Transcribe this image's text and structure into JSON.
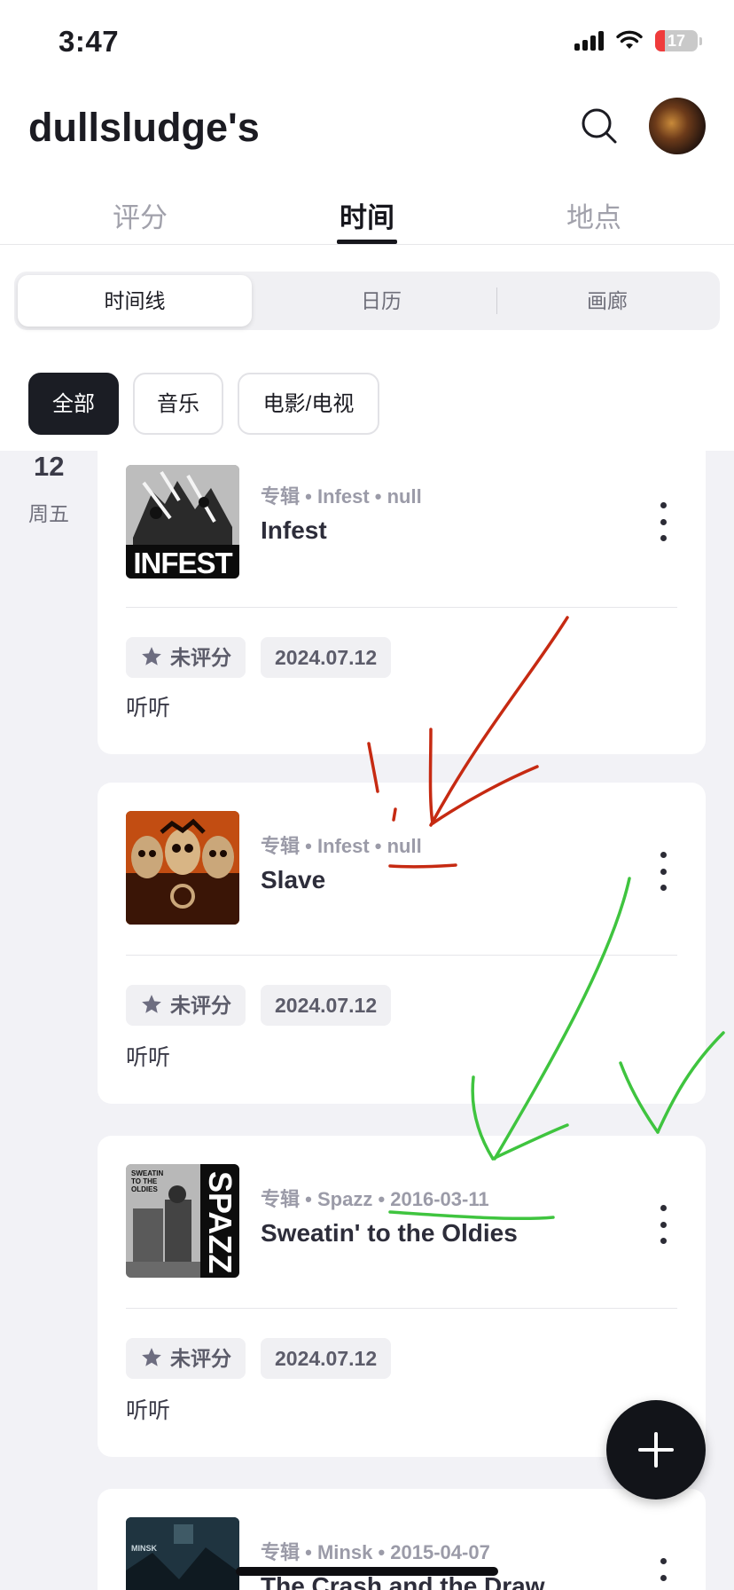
{
  "status_bar": {
    "time": "3:47",
    "battery": "17"
  },
  "header": {
    "title": "dullsludge's"
  },
  "tabs": [
    {
      "label": "评分",
      "active": false
    },
    {
      "label": "时间",
      "active": true
    },
    {
      "label": "地点",
      "active": false
    }
  ],
  "segments": [
    {
      "label": "时间线",
      "active": true
    },
    {
      "label": "日历",
      "active": false
    },
    {
      "label": "画廊",
      "active": false
    }
  ],
  "filters": [
    {
      "label": "全部",
      "active": true
    },
    {
      "label": "音乐",
      "active": false
    },
    {
      "label": "电影/电视",
      "active": false
    }
  ],
  "day": {
    "number": "12",
    "weekday": "周五"
  },
  "items": [
    {
      "type": "专辑",
      "artist": "Infest",
      "date": "null",
      "title": "Infest",
      "rating": "未评分",
      "logged_date": "2024.07.12",
      "note": "听听",
      "cover_text": "INFEST"
    },
    {
      "type": "专辑",
      "artist": "Infest",
      "date": "null",
      "title": "Slave",
      "rating": "未评分",
      "logged_date": "2024.07.12",
      "note": "听听"
    },
    {
      "type": "专辑",
      "artist": "Spazz",
      "date": "2016-03-11",
      "title": "Sweatin' to the Oldies",
      "rating": "未评分",
      "logged_date": "2024.07.12",
      "note": "听听",
      "cover_text": "SPAZZ",
      "cover_subtext": "SWEATIN TO THE OLDIES"
    },
    {
      "type": "专辑",
      "artist": "Minsk",
      "date": "2015-04-07",
      "title": "The Crash and the Draw",
      "cover_text": "MINSK"
    }
  ],
  "separator": "•",
  "annotation_colors": {
    "red": "#c62a12",
    "green": "#3fc43f"
  }
}
